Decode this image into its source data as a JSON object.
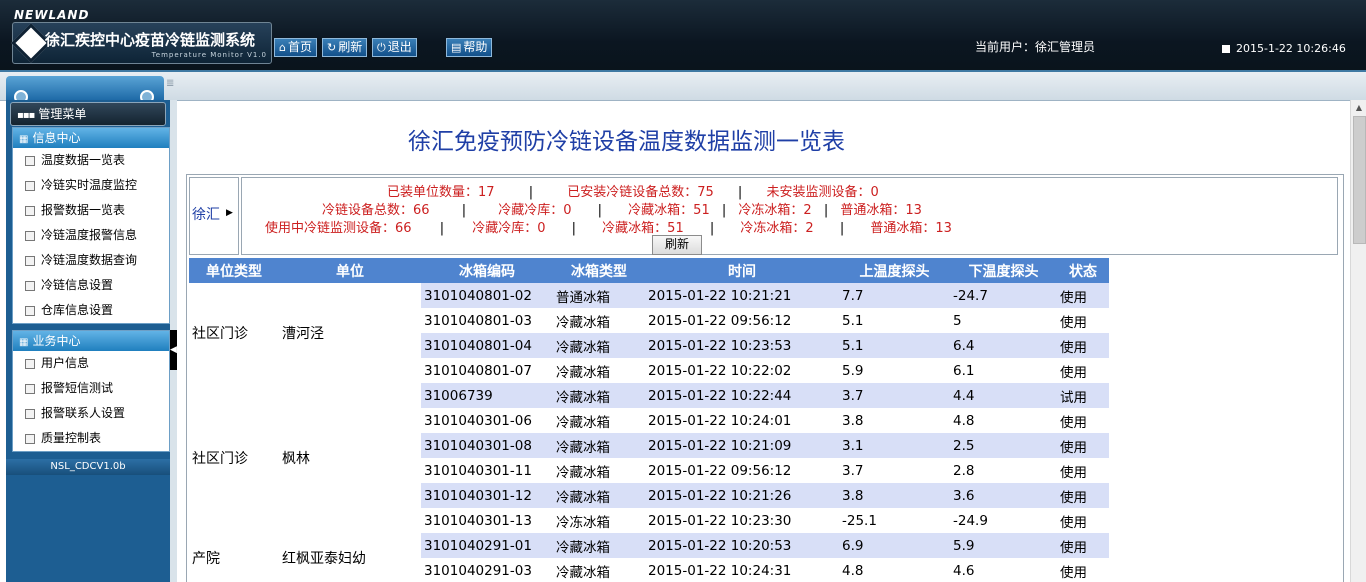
{
  "header": {
    "brand": "NEWLAND",
    "system_title": "徐汇疾控中心疫苗冷链监测系统",
    "system_subtitle": "Temperature Monitor V1.0",
    "buttons": [
      {
        "label": "首页",
        "icon": "home-icon"
      },
      {
        "label": "刷新",
        "icon": "refresh-icon"
      },
      {
        "label": "退出",
        "icon": "power-icon"
      },
      {
        "label": "帮助",
        "icon": "help-icon"
      }
    ],
    "current_user": "当前用户：徐汇管理员",
    "datetime": "2015-1-22 10:26:46"
  },
  "sidebar": {
    "menu_title": "管理菜单",
    "panels": [
      {
        "title": "信息中心",
        "items": [
          "温度数据一览表",
          "冷链实时温度监控",
          "报警数据一览表",
          "冷链温度报警信息",
          "冷链温度数据查询",
          "冷链信息设置",
          "仓库信息设置"
        ]
      },
      {
        "title": "业务中心",
        "items": [
          "用户信息",
          "报警短信测试",
          "报警联系人设置",
          "质量控制表"
        ]
      }
    ],
    "version": "NSL_CDCV1.0b"
  },
  "main": {
    "title": "徐汇免疫预防冷链设备温度数据监测一览表",
    "dept": "徐汇",
    "summary": {
      "line1": [
        "已装单位数量：17",
        "已安装冷链设备总数：75",
        "未安装监测设备：0"
      ],
      "line2": [
        "冷链设备总数：66",
        "冷藏冷库：0",
        "冷藏冰箱：51",
        "冷冻冰箱：2",
        "普通冰箱：13"
      ],
      "line3": [
        "使用中冷链监测设备：66",
        "冷藏冷库：0",
        "冷藏冰箱：51",
        "冷冻冰箱：2",
        "普通冰箱：13"
      ],
      "separator": "|",
      "refresh_label": "刷新"
    },
    "table": {
      "columns": [
        "单位类型",
        "单位",
        "冰箱编码",
        "冰箱类型",
        "时间",
        "上温度探头",
        "下温度探头",
        "状态"
      ],
      "groups": [
        {
          "unit_type": "社区门诊",
          "unit": "漕河泾",
          "rows": [
            [
              "3101040801-02",
              "普通冰箱",
              "2015-01-22 10:21:21",
              "7.7",
              "-24.7",
              "使用"
            ],
            [
              "3101040801-03",
              "冷藏冰箱",
              "2015-01-22 09:56:12",
              "5.1",
              "5",
              "使用"
            ],
            [
              "3101040801-04",
              "冷藏冰箱",
              "2015-01-22 10:23:53",
              "5.1",
              "6.4",
              "使用"
            ],
            [
              "3101040801-07",
              "冷藏冰箱",
              "2015-01-22 10:22:02",
              "5.9",
              "6.1",
              "使用"
            ]
          ]
        },
        {
          "unit_type": "社区门诊",
          "unit": "枫林",
          "rows": [
            [
              "31006739",
              "冷藏冰箱",
              "2015-01-22 10:22:44",
              "3.7",
              "4.4",
              "试用"
            ],
            [
              "3101040301-06",
              "冷藏冰箱",
              "2015-01-22 10:24:01",
              "3.8",
              "4.8",
              "使用"
            ],
            [
              "3101040301-08",
              "冷藏冰箱",
              "2015-01-22 10:21:09",
              "3.1",
              "2.5",
              "使用"
            ],
            [
              "3101040301-11",
              "冷藏冰箱",
              "2015-01-22 09:56:12",
              "3.7",
              "2.8",
              "使用"
            ],
            [
              "3101040301-12",
              "冷藏冰箱",
              "2015-01-22 10:21:26",
              "3.8",
              "3.6",
              "使用"
            ],
            [
              "3101040301-13",
              "冷冻冰箱",
              "2015-01-22 10:23:30",
              "-25.1",
              "-24.9",
              "使用"
            ]
          ]
        },
        {
          "unit_type": "产院",
          "unit": "红枫亚泰妇幼",
          "rows": [
            [
              "3101040291-01",
              "冷藏冰箱",
              "2015-01-22 10:20:53",
              "6.9",
              "5.9",
              "使用"
            ],
            [
              "3101040291-03",
              "冷藏冰箱",
              "2015-01-22 10:24:31",
              "4.8",
              "4.6",
              "使用"
            ]
          ]
        }
      ]
    }
  }
}
